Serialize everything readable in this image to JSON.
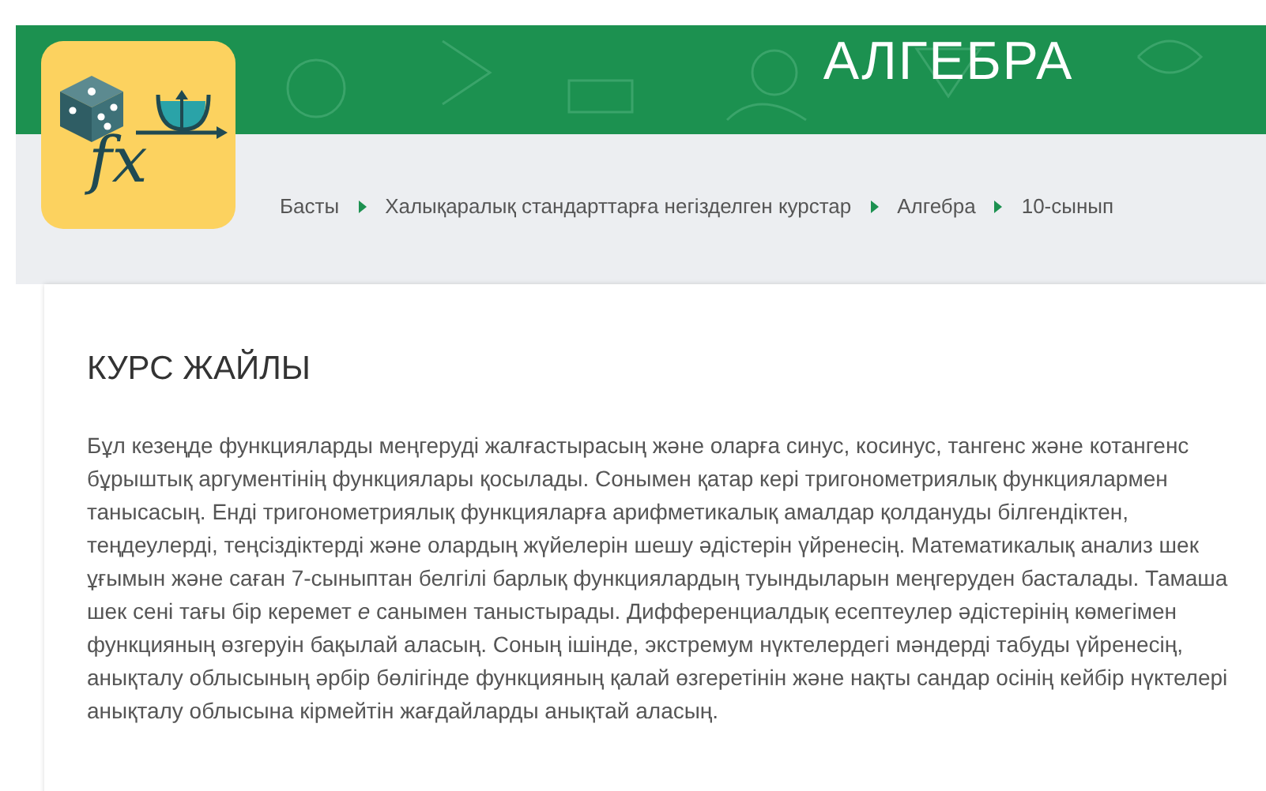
{
  "banner": {
    "title": "АЛГЕБРА"
  },
  "logo": {
    "text": "fx"
  },
  "breadcrumb": [
    {
      "label": "Басты"
    },
    {
      "label": "Халықаралық стандарттарға негізделген курстар"
    },
    {
      "label": "Алгебра"
    },
    {
      "label": "10-сынып"
    }
  ],
  "course": {
    "heading": "КУРС ЖАЙЛЫ",
    "description": "Бұл кезеңде функцияларды меңгеруді жалғастырасың және оларға синус, косинус, тангенс және котангенс бұрыштық аргументінің функциялары қосылады. Сонымен қатар кері тригонометриялық функциялармен танысасың. Енді тригонометриялық функцияларға арифметикалық амалдар қолдануды білгендіктен, теңдеулерді, теңсіздіктерді және олардың жүйелерін шешу әдістерін үйренесің. Математикалық анализ шек ұғымын және саған 7-сыныптан белгілі барлық функциялардың туындыларын меңгеруден басталады. Тамаша шек сені тағы бір керемет *е* санымен таныстырады. Дифференциалдық есептеулер әдістерінің көмегімен функцияның өзгеруін бақылай аласың. Соның ішінде, экстремум нүктелердегі мәндерді табуды үйренесің, анықталу облысының әрбір бөлігінде функцияның қалай өзгеретінін және нақты сандар осінің кейбір нүктелері анықталу облысына кірмейтін жағдайларды анықтай аласың."
  }
}
